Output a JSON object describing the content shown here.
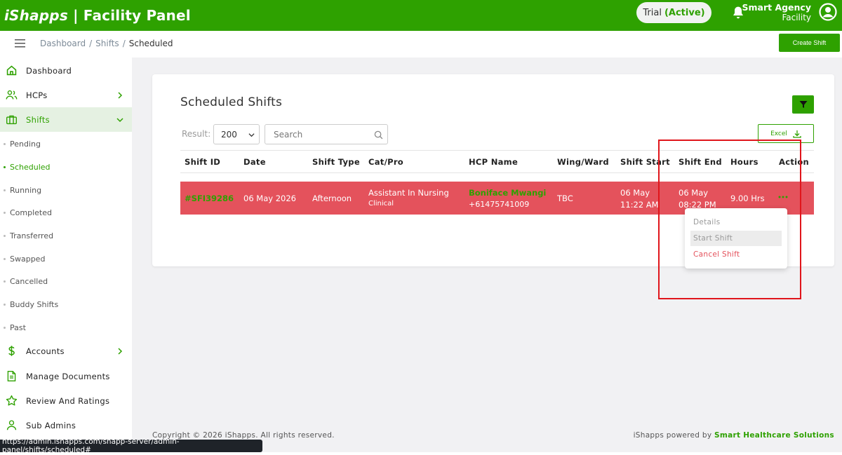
{
  "header": {
    "brand_prefix": "iShapps",
    "brand_suffix": " | Facility Panel",
    "trial_label": "Trial",
    "trial_status": "(Active)",
    "user_name": "Smart Agency",
    "user_role": "Facility"
  },
  "breadcrumb": {
    "items": [
      "Dashboard",
      "Shifts"
    ],
    "current": "Scheduled",
    "separator": "/"
  },
  "toolbar": {
    "create_label": "Create Shift"
  },
  "sidebar": {
    "items": [
      {
        "label": "Dashboard",
        "icon": "home-icon"
      },
      {
        "label": "HCPs",
        "icon": "users-icon"
      },
      {
        "label": "Shifts",
        "icon": "briefcase-icon"
      },
      {
        "label": "Accounts",
        "icon": "dollar-icon"
      },
      {
        "label": "Manage Documents",
        "icon": "document-icon"
      },
      {
        "label": "Review And Ratings",
        "icon": "star-icon"
      },
      {
        "label": "Sub Admins",
        "icon": "user-icon"
      }
    ],
    "shift_subitems": [
      "Pending",
      "Scheduled",
      "Running",
      "Completed",
      "Transferred",
      "Swapped",
      "Cancelled",
      "Buddy Shifts",
      "Past"
    ]
  },
  "card": {
    "title": "Scheduled Shifts",
    "result_label": "Result:",
    "result_value": "200",
    "search_placeholder": "Search",
    "excel_label": "Excel"
  },
  "table": {
    "columns": [
      "Shift ID",
      "Date",
      "Shift Type",
      "Cat/Pro",
      "HCP Name",
      "Wing/Ward",
      "Shift Start",
      "Shift End",
      "Hours",
      "Action"
    ],
    "rows": [
      {
        "shift_id": "#SFI39286",
        "date": "06 May 2026",
        "shift_type": "Afternoon",
        "cat": "Assistant In Nursing",
        "pro": "Clinical",
        "hcp_name": "Boniface Mwangi",
        "hcp_phone": "+61475741009",
        "wing": "TBC",
        "start_date": "06 May",
        "start_time": "11:22 AM",
        "end_date": "06 May",
        "end_time": "08:22 PM",
        "hours": "9.00 Hrs"
      }
    ]
  },
  "action_menu": [
    "Details",
    "Start Shift",
    "Cancel Shift"
  ],
  "footer": {
    "copyright": "Copyright © 2026 iShapps. All rights reserved.",
    "powered_prefix": "iShapps powered by ",
    "powered_by": "Smart Healthcare Solutions"
  },
  "status_url": "https://admin.ishapps.com/shapp-server/admin-panel/shifts/scheduled#",
  "colors": {
    "brand": "#2ea100",
    "row_highlight": "#e4525c",
    "annotation": "#e0151b"
  }
}
